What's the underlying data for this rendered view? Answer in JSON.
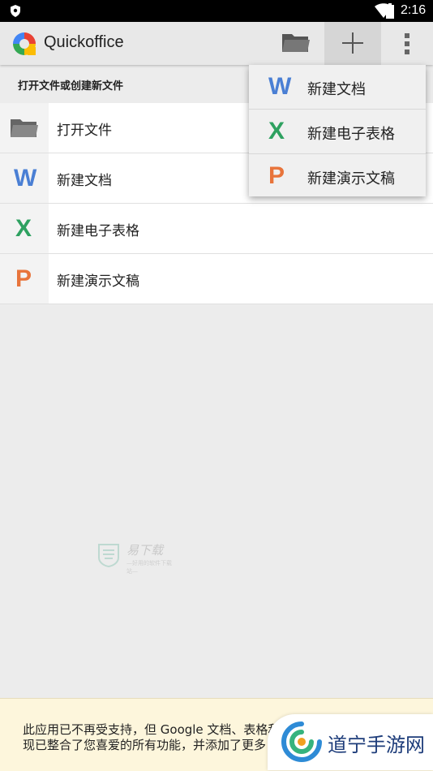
{
  "status_bar": {
    "time": "2:16"
  },
  "app_bar": {
    "title": "Quickoffice"
  },
  "section_header": "打开文件或创建新文件",
  "list_items": [
    {
      "label": "打开文件",
      "icon": "folder-icon"
    },
    {
      "label": "新建文档",
      "icon": "word-icon",
      "letter": "W"
    },
    {
      "label": "新建电子表格",
      "icon": "excel-icon",
      "letter": "X"
    },
    {
      "label": "新建演示文稿",
      "icon": "powerpoint-icon",
      "letter": "P"
    }
  ],
  "dropdown_menu": [
    {
      "label": "新建文档",
      "icon": "word-icon",
      "letter": "W"
    },
    {
      "label": "新建电子表格",
      "icon": "excel-icon",
      "letter": "X"
    },
    {
      "label": "新建演示文稿",
      "icon": "powerpoint-icon",
      "letter": "P"
    }
  ],
  "watermark": {
    "text": "易下载",
    "subtext": "—好用的软件下载站—"
  },
  "bottom_notice": {
    "line1": "此应用已不再受支持，但 Google 文档、表格和幻灯片",
    "line2": "现已整合了您喜爱的所有功能，并添加了更多"
  },
  "badge": {
    "text": "道宁手游网"
  },
  "colors": {
    "word": "#4a7fd4",
    "excel": "#2ea160",
    "powerpoint": "#e8743b",
    "notice_bg": "#fdf6dc"
  }
}
